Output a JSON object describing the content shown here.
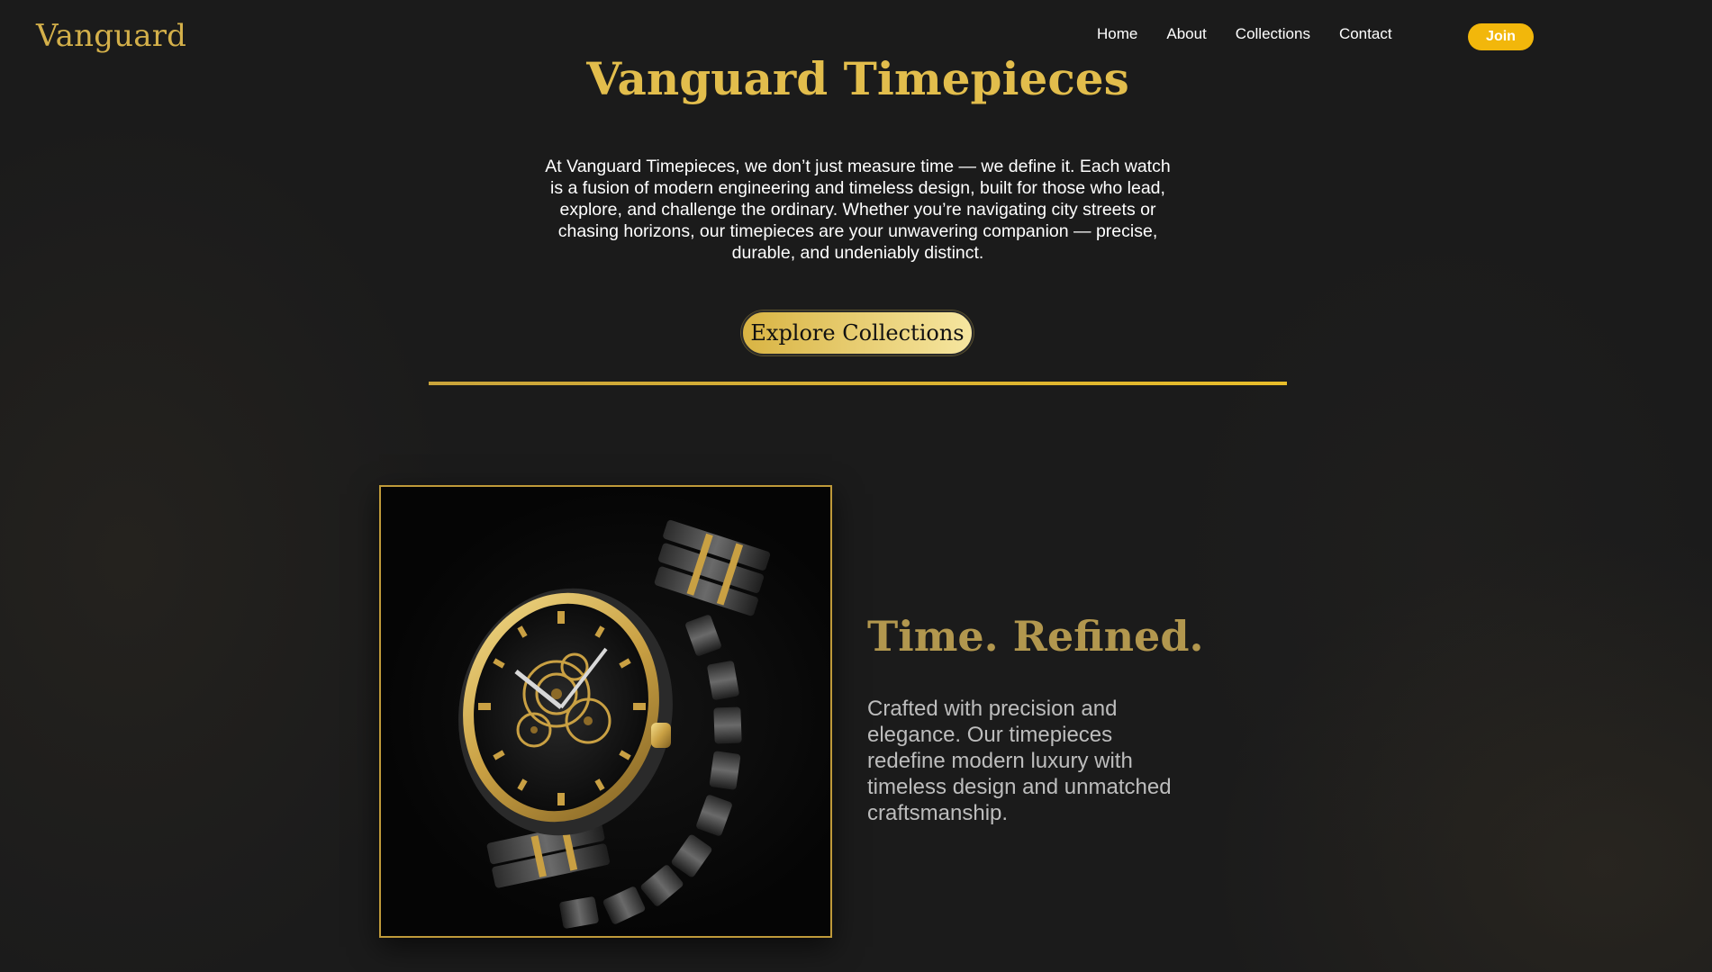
{
  "header": {
    "logo": "Vanguard",
    "nav": [
      "Home",
      "About",
      "Collections",
      "Contact"
    ],
    "join_label": "Join"
  },
  "hero": {
    "title": "Vanguard Timepieces",
    "text": "At Vanguard Timepieces, we don’t just measure time — we define it. Each watch is a fusion of modern engineering and timeless design, built for those who lead, explore, and challenge the ordinary. Whether you’re navigating city streets or chasing horizons, our timepieces are your unwavering companion — precise, durable, and undeniably distinct.",
    "cta_label": "Explore Collections"
  },
  "feature": {
    "title": "Time. Refined.",
    "text": "Crafted with precision and elegance. Our timepieces redefine modern luxury with timeless design and unmatched craftsmanship."
  },
  "colors": {
    "background": "#1b1b1b",
    "gold": "#e2bd4c",
    "join_button": "#f2b70b",
    "divider": "#e8bd2a",
    "feature_title": "#b2974e"
  },
  "icons": {
    "watch_image": "skeleton-wristwatch-image"
  }
}
